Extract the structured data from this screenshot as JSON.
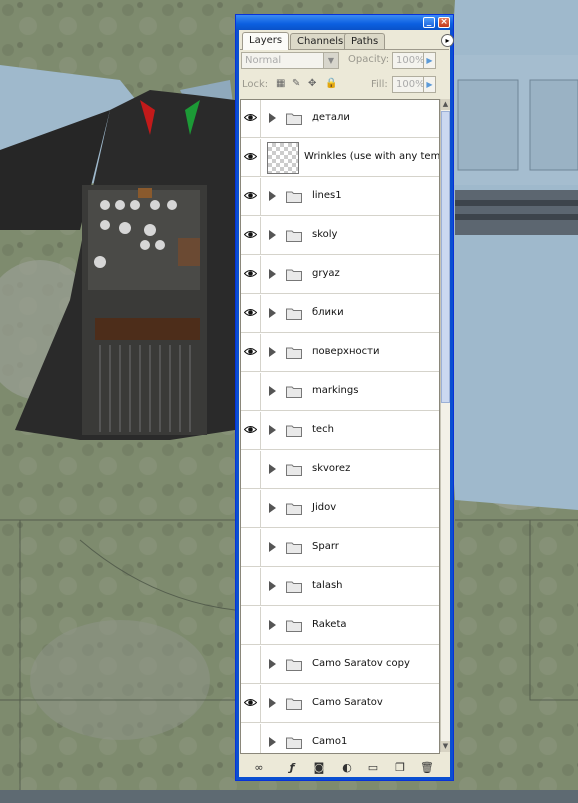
{
  "panel": {
    "tabs": [
      {
        "label": "Layers",
        "active": true
      },
      {
        "label": "Channels",
        "active": false
      },
      {
        "label": "Paths",
        "active": false
      }
    ],
    "blend_mode": "Normal",
    "opacity_label": "Opacity:",
    "opacity_value": "100%",
    "lock_label": "Lock:",
    "fill_label": "Fill:",
    "fill_value": "100%",
    "menu_icon": "panel-menu-arrow-icon"
  },
  "layers": [
    {
      "name": "детали",
      "visible": true,
      "type": "group"
    },
    {
      "name": "Wrinkles (use with any temp...",
      "visible": true,
      "type": "layer"
    },
    {
      "name": "lines1",
      "visible": true,
      "type": "group"
    },
    {
      "name": "skoly",
      "visible": true,
      "type": "group"
    },
    {
      "name": "gryaz",
      "visible": true,
      "type": "group"
    },
    {
      "name": "блики",
      "visible": true,
      "type": "group"
    },
    {
      "name": "поверхности",
      "visible": true,
      "type": "group"
    },
    {
      "name": "markings",
      "visible": false,
      "type": "group"
    },
    {
      "name": "tech",
      "visible": true,
      "type": "group"
    },
    {
      "name": "skvorez",
      "visible": false,
      "type": "group"
    },
    {
      "name": "Jidov",
      "visible": false,
      "type": "group"
    },
    {
      "name": "Sparr",
      "visible": false,
      "type": "group"
    },
    {
      "name": "talash",
      "visible": false,
      "type": "group"
    },
    {
      "name": "Raketa",
      "visible": false,
      "type": "group"
    },
    {
      "name": "Camo Saratov copy",
      "visible": false,
      "type": "group"
    },
    {
      "name": "Camo Saratov",
      "visible": true,
      "type": "group"
    },
    {
      "name": "Camo1",
      "visible": false,
      "type": "group"
    }
  ],
  "bottom_icons": [
    "link-layers-icon",
    "layer-style-icon",
    "add-mask-icon",
    "adjustment-layer-icon",
    "new-group-icon",
    "new-layer-icon",
    "delete-layer-icon"
  ],
  "colors": {
    "titlebar": "#0b5fe0",
    "panel_bg": "#ece9d8",
    "sky_blue_skin": "#9fb9cc",
    "camo_green": "#7c8a6a"
  }
}
